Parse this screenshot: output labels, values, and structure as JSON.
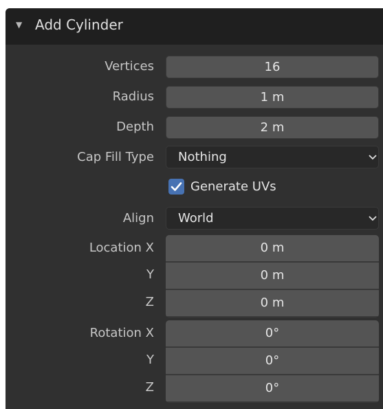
{
  "panel": {
    "title": "Add Cylinder",
    "colors": {
      "panel_bg": "#303030",
      "header_bg": "#1f1f1f",
      "field_bg": "#545454",
      "dropdown_bg": "#282828",
      "checkbox_accent": "#4772b3"
    }
  },
  "fields": {
    "vertices": {
      "label": "Vertices",
      "value": "16"
    },
    "radius": {
      "label": "Radius",
      "value": "1 m"
    },
    "depth": {
      "label": "Depth",
      "value": "2 m"
    },
    "cap_fill_type": {
      "label": "Cap Fill Type",
      "value": "Nothing"
    },
    "generate_uvs": {
      "label": "Generate UVs",
      "checked": true
    },
    "align": {
      "label": "Align",
      "value": "World"
    },
    "location": {
      "label_x": "Location X",
      "label_y": "Y",
      "label_z": "Z",
      "x": "0 m",
      "y": "0 m",
      "z": "0 m"
    },
    "rotation": {
      "label_x": "Rotation X",
      "label_y": "Y",
      "label_z": "Z",
      "x": "0°",
      "y": "0°",
      "z": "0°"
    }
  },
  "icons": {
    "collapse": "triangle-down-icon",
    "dropdown": "chevron-down-icon",
    "check": "checkmark-icon"
  }
}
